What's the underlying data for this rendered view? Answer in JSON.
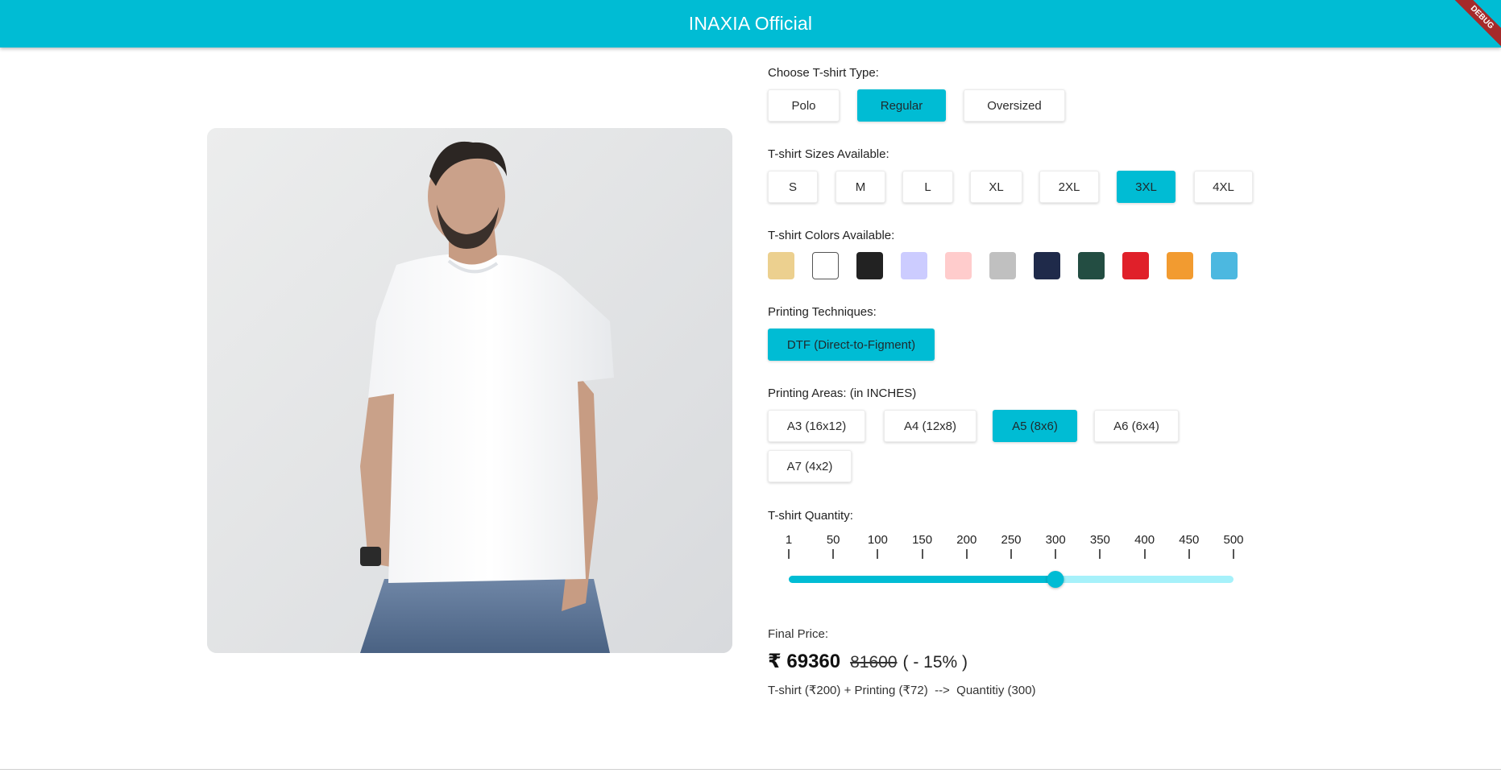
{
  "app": {
    "title": "INAXIA Official",
    "debug_banner": "DEBUG",
    "accent_color": "#00bcd4"
  },
  "product_image": {
    "alt": "Model wearing white regular fit t-shirt"
  },
  "type_section": {
    "label": "Choose T-shirt Type:",
    "options": [
      "Polo",
      "Regular",
      "Oversized"
    ],
    "selected": "Regular"
  },
  "size_section": {
    "label": "T-shirt Sizes Available:",
    "options": [
      "S",
      "M",
      "L",
      "XL",
      "2XL",
      "3XL",
      "4XL"
    ],
    "selected": "3XL"
  },
  "color_section": {
    "label": "T-shirt Colors Available:",
    "swatches": [
      "#ecd08f",
      "#ffffff",
      "#222222",
      "#ccccff",
      "#ffcccc",
      "#c0c0c0",
      "#1f2a4a",
      "#234d42",
      "#e0202a",
      "#f29b30",
      "#4cb8e0"
    ]
  },
  "technique_section": {
    "label": "Printing Techniques:",
    "options": [
      "DTF (Direct-to-Figment)"
    ],
    "selected": "DTF (Direct-to-Figment)"
  },
  "area_section": {
    "label": "Printing Areas: (in INCHES)",
    "options": [
      "A3 (16x12)",
      "A4 (12x8)",
      "A5 (8x6)",
      "A6 (6x4)",
      "A7 (4x2)"
    ],
    "selected": "A5 (8x6)"
  },
  "quantity_section": {
    "label": "T-shirt Quantity:",
    "ticks": [
      "1",
      "50",
      "100",
      "150",
      "200",
      "250",
      "300",
      "350",
      "400",
      "450",
      "500"
    ],
    "min": 1,
    "max": 500,
    "value": 300
  },
  "price": {
    "label": "Final Price:",
    "current": "₹ 69360",
    "original": "81600",
    "discount": "( - 15% )",
    "breakdown": "T-shirt (₹200) + Printing (₹72)  -->  Quantitiy (300)"
  }
}
